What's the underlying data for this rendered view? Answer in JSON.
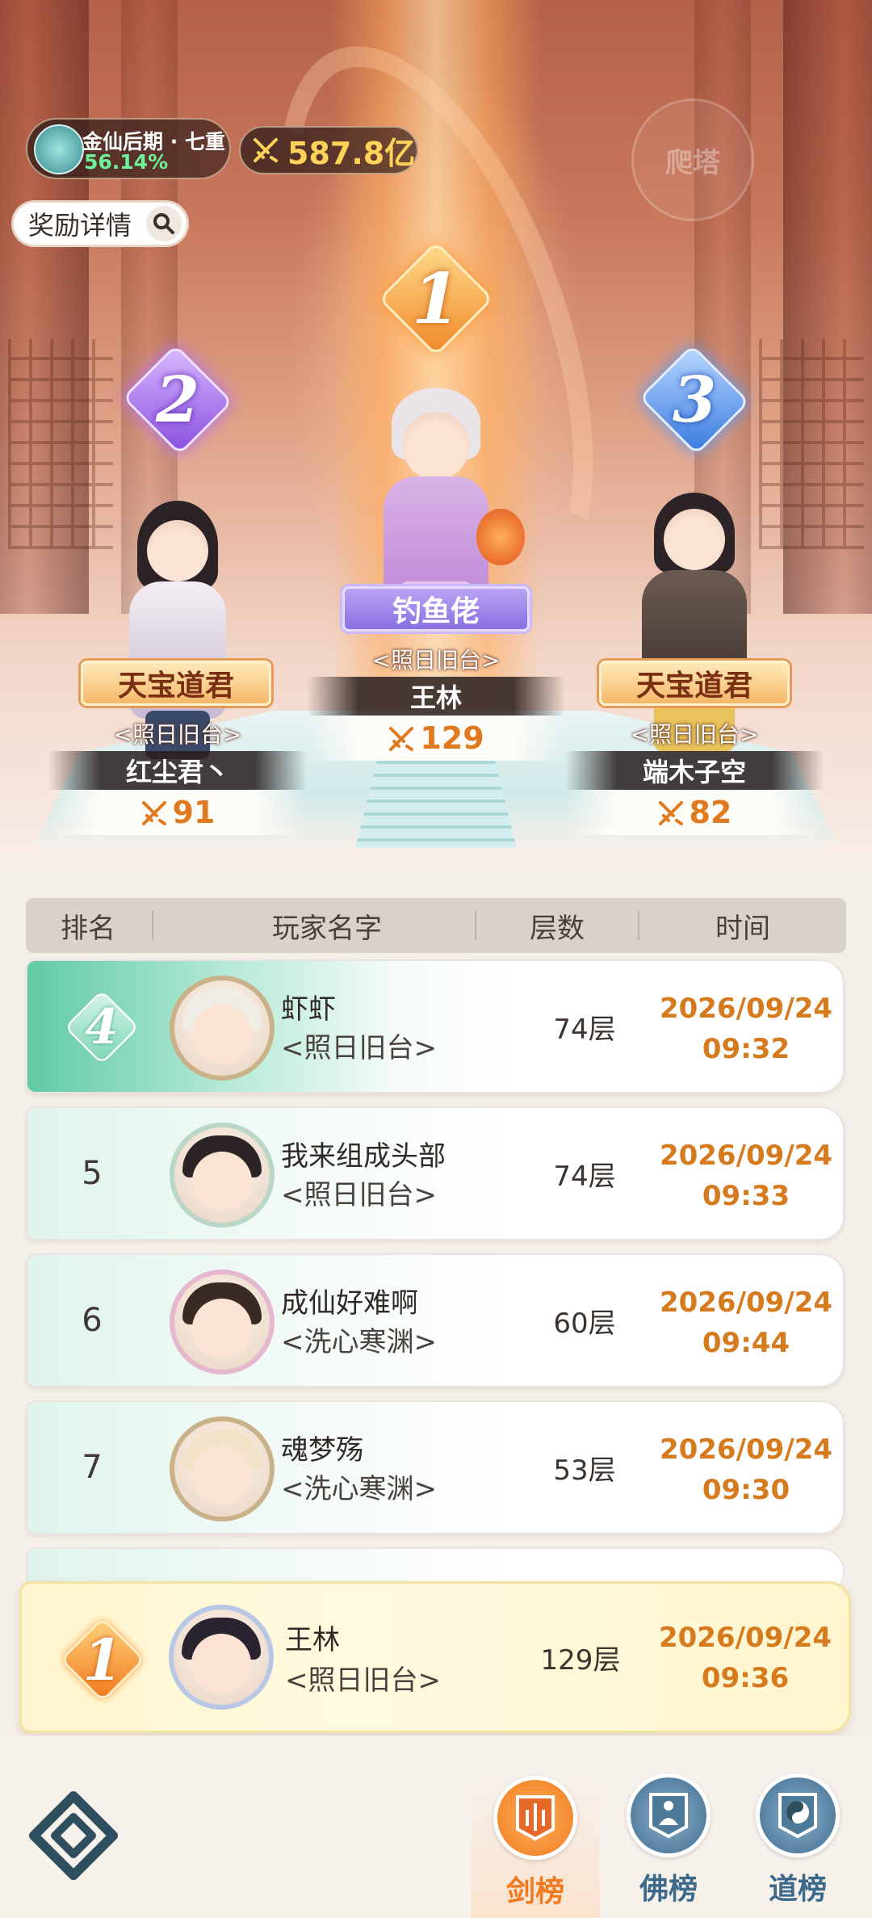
{
  "hud": {
    "realm_name": "金仙后期 · 七重",
    "realm_progress": "56.14%",
    "combat_power": "587.8亿",
    "climb_label": "爬塔",
    "reward_label": "奖励详情"
  },
  "podium": {
    "first": {
      "rank": "1",
      "title": "钓鱼佬",
      "guild": "<照日旧台>",
      "name": "王林",
      "score": "129"
    },
    "second": {
      "rank": "2",
      "title": "天宝道君",
      "guild": "<照日旧台>",
      "name": "红尘君丶",
      "score": "91"
    },
    "third": {
      "rank": "3",
      "title": "天宝道君",
      "guild": "<照日旧台>",
      "name": "端木子空",
      "score": "82"
    }
  },
  "table": {
    "headers": [
      "排名",
      "玩家名字",
      "层数",
      "时间"
    ],
    "rows": [
      {
        "rank": "4",
        "name": "虾虾",
        "guild": "<照日旧台>",
        "floor": "74层",
        "date": "2026/09/24",
        "time": "09:32"
      },
      {
        "rank": "5",
        "name": "我来组成头部",
        "guild": "<照日旧台>",
        "floor": "74层",
        "date": "2026/09/24",
        "time": "09:33"
      },
      {
        "rank": "6",
        "name": "成仙好难啊",
        "guild": "<洗心寒渊>",
        "floor": "60层",
        "date": "2026/09/24",
        "time": "09:44"
      },
      {
        "rank": "7",
        "name": "魂梦殇",
        "guild": "<洗心寒渊>",
        "floor": "53层",
        "date": "2026/09/24",
        "time": "09:30"
      }
    ]
  },
  "my_entry": {
    "rank": "1",
    "name": "王林",
    "guild": "<照日旧台>",
    "floor": "129层",
    "date": "2026/09/24",
    "time": "09:36"
  },
  "tabs": [
    {
      "label": "剑榜",
      "active": true
    },
    {
      "label": "佛榜",
      "active": false
    },
    {
      "label": "道榜",
      "active": false
    }
  ],
  "colors": {
    "accent": "#f07a20",
    "time_text": "#d67a1e",
    "progress_green": "#6ef29b",
    "power_gold": "#ffd25a"
  }
}
